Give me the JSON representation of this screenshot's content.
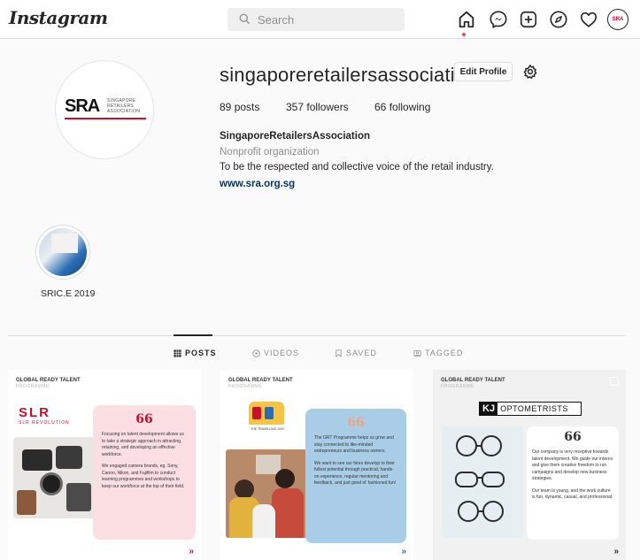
{
  "brand": {
    "logo_text": "Instagram"
  },
  "search": {
    "placeholder": "Search"
  },
  "nav": {
    "icons": [
      "home-icon",
      "messenger-icon",
      "new-post-icon",
      "explore-icon",
      "activity-heart-icon",
      "profile-avatar-icon"
    ],
    "avatar_text": "SRA"
  },
  "profile": {
    "username": "singaporeretailersassociation",
    "edit_label": "Edit Profile",
    "posts_count": "89",
    "posts_label": "posts",
    "followers_count": "357",
    "followers_label": "followers",
    "following_count": "66",
    "following_label": "following",
    "display_name": "SingaporeRetailersAssociation",
    "category": "Nonprofit organization",
    "bio": "To be the respected and collective voice of the retail industry.",
    "website": "www.sra.org.sg",
    "avatar_logo": {
      "letters": "SRA",
      "sub": "SINGAPORE RETAILERS ASSOCIATION"
    }
  },
  "highlights": [
    {
      "label": "SRIC.E 2019"
    }
  ],
  "tabs": [
    {
      "label": "POSTS",
      "icon": "grid-icon",
      "active": true
    },
    {
      "label": "VIDEOS",
      "icon": "video-icon",
      "active": false
    },
    {
      "label": "SAVED",
      "icon": "bookmark-icon",
      "active": false
    },
    {
      "label": "TAGGED",
      "icon": "tag-icon",
      "active": false
    }
  ],
  "posts": [
    {
      "header": "GLOBAL READY TALENT",
      "subheader": "PROGRAMME",
      "brand": "SLR REVOLUTION",
      "quote": "66",
      "text1": "Focusing on talent development allows us to take a strategic approach in attracting, retaining, and developing an effective workforce.",
      "text2": "We engaged camera brands, eg. Sony, Canon, Nikon, and Fujifilm to conduct learning programmes and workshops to keep our workforce at the top of their field."
    },
    {
      "header": "GLOBAL READY TALENT",
      "subheader": "PROGRAMME",
      "brand": "THE TRAVELLING SOX",
      "quote": "66",
      "text1": "The GRT Programme helps us grow and stay connected to like-minded entrepreneurs and business owners.",
      "text2": "We want to see our hires develop to their fullest potential through practical, hands-on experience, regular mentoring and feedback, and just good ol' fashioned fun!"
    },
    {
      "header": "GLOBAL READY TALENT",
      "subheader": "PROGRAMME",
      "brand": "KJ OPTOMETRISTS",
      "quote": "66",
      "text1": "Our company is very receptive towards talent development. We guide our interns and give them creative freedom to run campaigns and develop new business strategies.",
      "text2": "Our team is young, and the work culture is fun, dynamic, casual, and professional."
    }
  ],
  "colors": {
    "accent": "#c8102e",
    "link": "#00376b",
    "muted": "#8e8e8e",
    "post1_card": "#fbdfe3",
    "post2_card": "#a9cde6",
    "post3_bg": "#f1f1f1"
  }
}
